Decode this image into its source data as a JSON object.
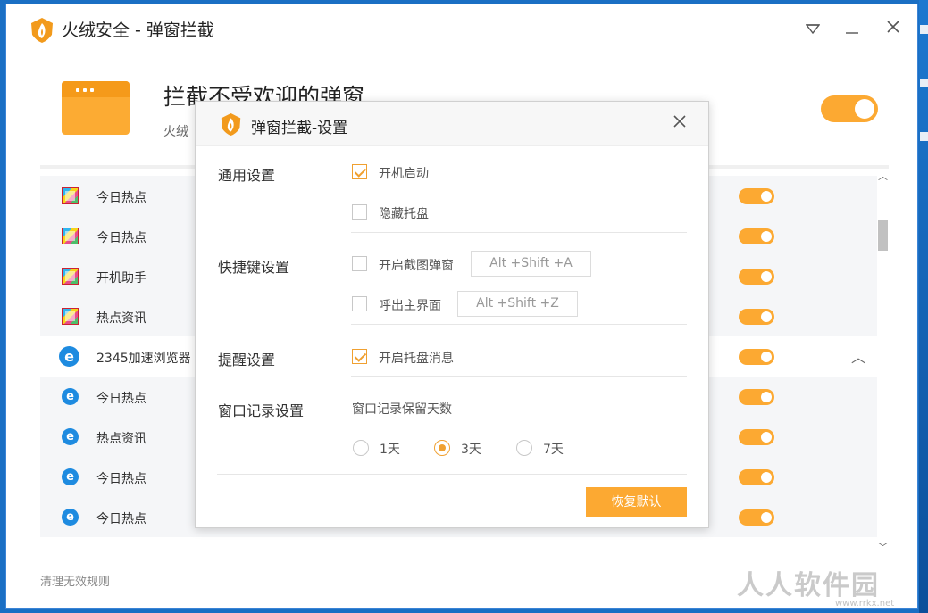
{
  "app": {
    "title": "火绒安全 - 弹窗拦截",
    "brand_color": "#fca932"
  },
  "header": {
    "title": "拦截不受欢迎的弹窗",
    "subtitle": "火绒",
    "main_toggle_on": true
  },
  "list": {
    "rows": [
      {
        "label": "今日热点",
        "icon": "popup-window-icon",
        "type": "child",
        "on": true
      },
      {
        "label": "今日热点",
        "icon": "popup-window-icon",
        "type": "child",
        "on": true
      },
      {
        "label": "开机助手",
        "icon": "popup-window-icon",
        "type": "child",
        "on": true
      },
      {
        "label": "热点资讯",
        "icon": "popup-window-icon",
        "type": "child",
        "on": true
      },
      {
        "label": "2345加速浏览器",
        "icon": "browser-e-icon",
        "type": "parent",
        "on": true
      },
      {
        "label": "今日热点",
        "icon": "browser-e-icon",
        "type": "child",
        "on": true
      },
      {
        "label": "热点资讯",
        "icon": "browser-e-icon",
        "type": "child",
        "on": true
      },
      {
        "label": "今日热点",
        "icon": "browser-e-icon",
        "type": "child",
        "on": true
      },
      {
        "label": "今日热点",
        "icon": "browser-e-icon",
        "type": "child",
        "on": true
      }
    ]
  },
  "footer": {
    "clean_link": "清理无效规则",
    "watermark": "人人软件园",
    "watermark_url": "www.rrkx.net"
  },
  "dialog": {
    "title": "弹窗拦截-设置",
    "general": {
      "label": "通用设置",
      "autostart": "开机启动",
      "autostart_checked": true,
      "hide_tray": "隐藏托盘",
      "hide_tray_checked": false
    },
    "hotkey": {
      "label": "快捷键设置",
      "screenshot": "开启截图弹窗",
      "screenshot_checked": false,
      "screenshot_key": "Alt +Shift +A",
      "main_ui": "呼出主界面",
      "main_ui_checked": false,
      "main_ui_key": "Alt +Shift +Z"
    },
    "reminder": {
      "label": "提醒设置",
      "tray_msg": "开启托盘消息",
      "tray_msg_checked": true
    },
    "record": {
      "label": "窗口记录设置",
      "desc": "窗口记录保留天数",
      "options": [
        "1天",
        "3天",
        "7天"
      ],
      "selected": "3天"
    },
    "reset_label": "恢复默认"
  }
}
